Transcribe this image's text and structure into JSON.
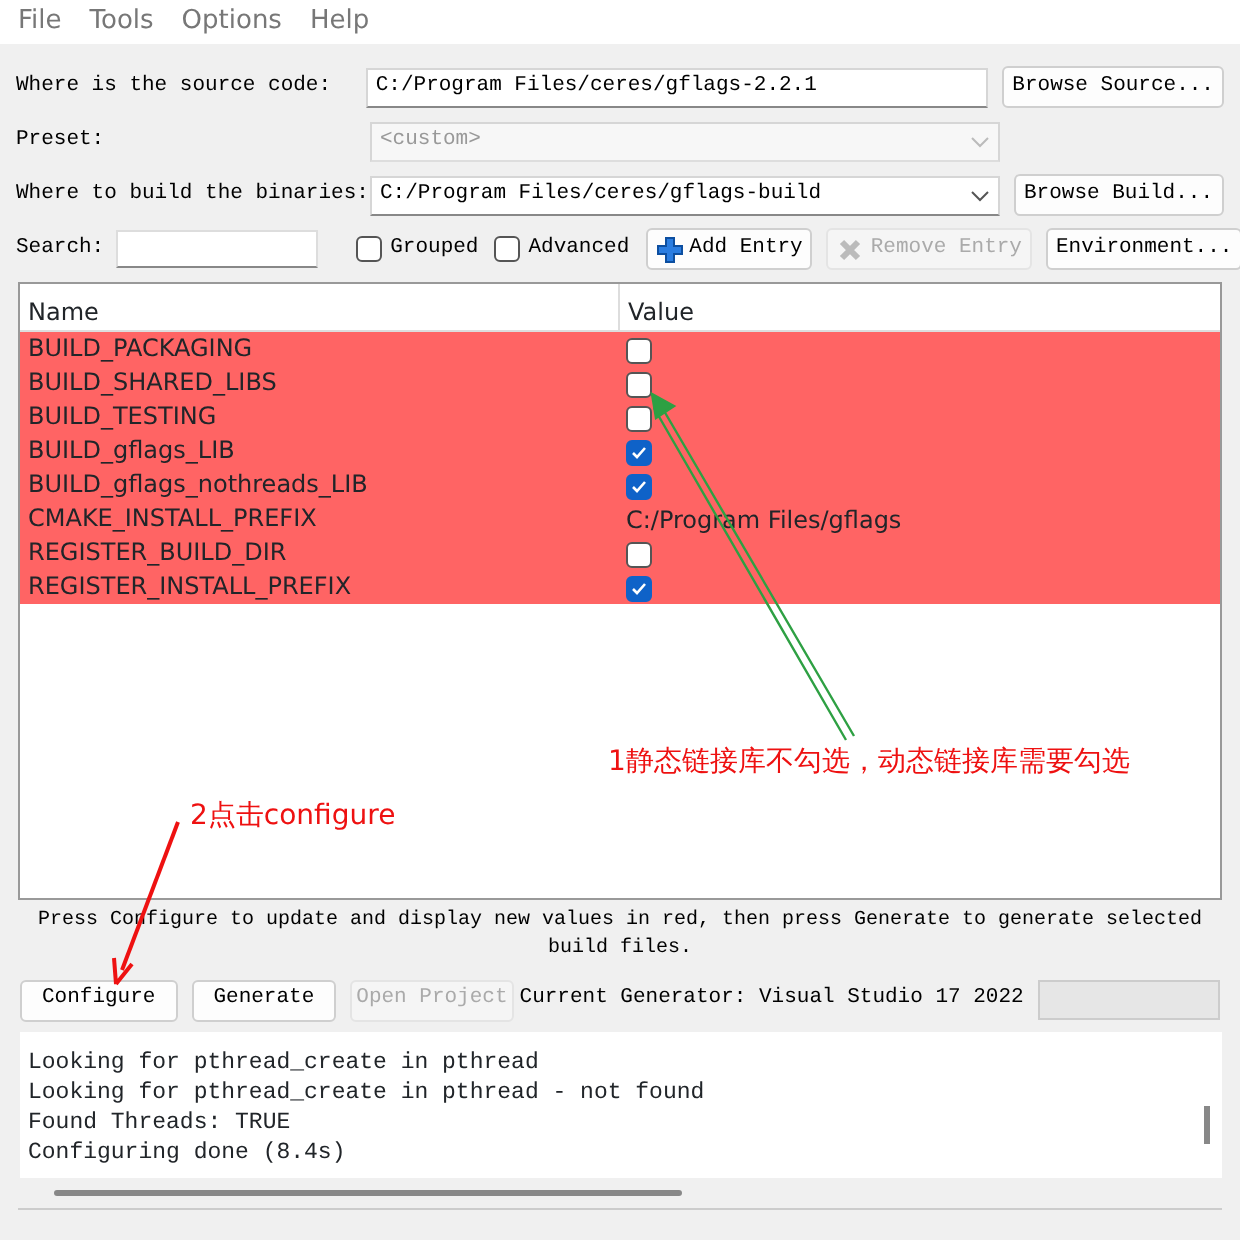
{
  "menu": [
    "File",
    "Tools",
    "Options",
    "Help"
  ],
  "source": {
    "label": "Where is the source code:",
    "value": "C:/Program Files/ceres/gflags-2.2.1",
    "button": "Browse Source..."
  },
  "preset": {
    "label": "Preset:",
    "value": "<custom>",
    "disabled": true
  },
  "build": {
    "label": "Where to build the binaries:",
    "value": "C:/Program Files/ceres/gflags-build",
    "button": "Browse Build..."
  },
  "search": {
    "label": "Search:"
  },
  "options": [
    {
      "label": "Grouped",
      "checked": false
    },
    {
      "label": "Advanced",
      "checked": false
    }
  ],
  "toolbar_buttons": [
    {
      "label": "Add Entry",
      "kind": "add",
      "disabled": false
    },
    {
      "label": "Remove Entry",
      "kind": "remove",
      "disabled": true
    },
    {
      "label": "Environment...",
      "kind": "plain",
      "disabled": false
    }
  ],
  "table": {
    "columns": [
      "Name",
      "Value"
    ],
    "rows": [
      {
        "name": "BUILD_PACKAGING",
        "kind": "bool",
        "checked": false,
        "highlighted": true
      },
      {
        "name": "BUILD_SHARED_LIBS",
        "kind": "bool",
        "checked": false,
        "highlighted": true
      },
      {
        "name": "BUILD_TESTING",
        "kind": "bool",
        "checked": false,
        "highlighted": true
      },
      {
        "name": "BUILD_gflags_LIB",
        "kind": "bool",
        "checked": true,
        "highlighted": true
      },
      {
        "name": "BUILD_gflags_nothreads_LIB",
        "kind": "bool",
        "checked": true,
        "highlighted": true
      },
      {
        "name": "CMAKE_INSTALL_PREFIX",
        "kind": "text",
        "value": "C:/Program Files/gflags",
        "highlighted": true
      },
      {
        "name": "REGISTER_BUILD_DIR",
        "kind": "bool",
        "checked": false,
        "highlighted": true
      },
      {
        "name": "REGISTER_INSTALL_PREFIX",
        "kind": "bool",
        "checked": true,
        "highlighted": true
      }
    ]
  },
  "note": "Press Configure to update and display new values in red, then press Generate to generate selected build files.",
  "actions": [
    {
      "label": "Configure",
      "disabled": false
    },
    {
      "label": "Generate",
      "disabled": false
    },
    {
      "label": "Open Project",
      "disabled": true
    }
  ],
  "generator": "Current Generator: Visual Studio 17 2022",
  "progress": {
    "level": 0
  },
  "log": [
    "Looking for pthread_create in pthread",
    "Looking for pthread_create in pthread - not found",
    "Found Threads: TRUE",
    "Configuring done (8.4s)"
  ],
  "annotations": [
    {
      "text": "1静态链接库不勾选，动态链接库需要勾选",
      "color": "#2ea043"
    },
    {
      "text": "2点击configure",
      "color": "#ee1111"
    }
  ]
}
